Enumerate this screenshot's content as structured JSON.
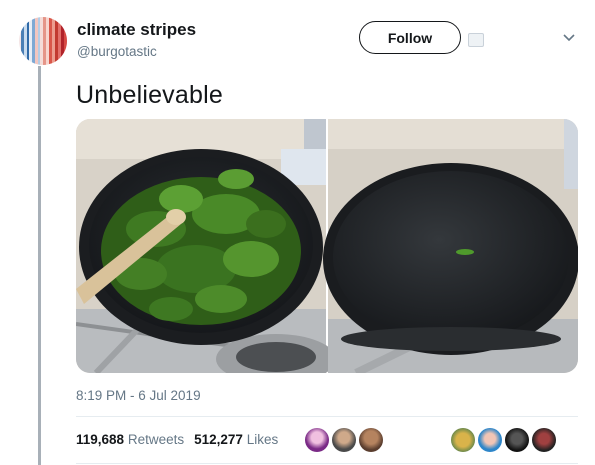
{
  "author": {
    "display_name": "climate stripes",
    "handle": "@burgotastic"
  },
  "follow_button": {
    "label": "Follow"
  },
  "tweet": {
    "text": "Unbelievable",
    "timestamp": "8:19 PM - 6 Jul 2019"
  },
  "stats": {
    "retweets_count": "119,688",
    "retweets_label": "Retweets",
    "likes_count": "512,277",
    "likes_label": "Likes"
  },
  "icons": {
    "caret": "chevron-down-icon",
    "follow_extra": "placeholder-image-icon"
  },
  "media": {
    "photos": [
      "frying pan full of spinach",
      "frying pan with single cooked spinach leaf"
    ]
  },
  "colors": {
    "primary_text": "#14171a",
    "secondary_text": "#657786",
    "divider": "#e6ecf0",
    "thread_line": "#a8b0b8"
  }
}
